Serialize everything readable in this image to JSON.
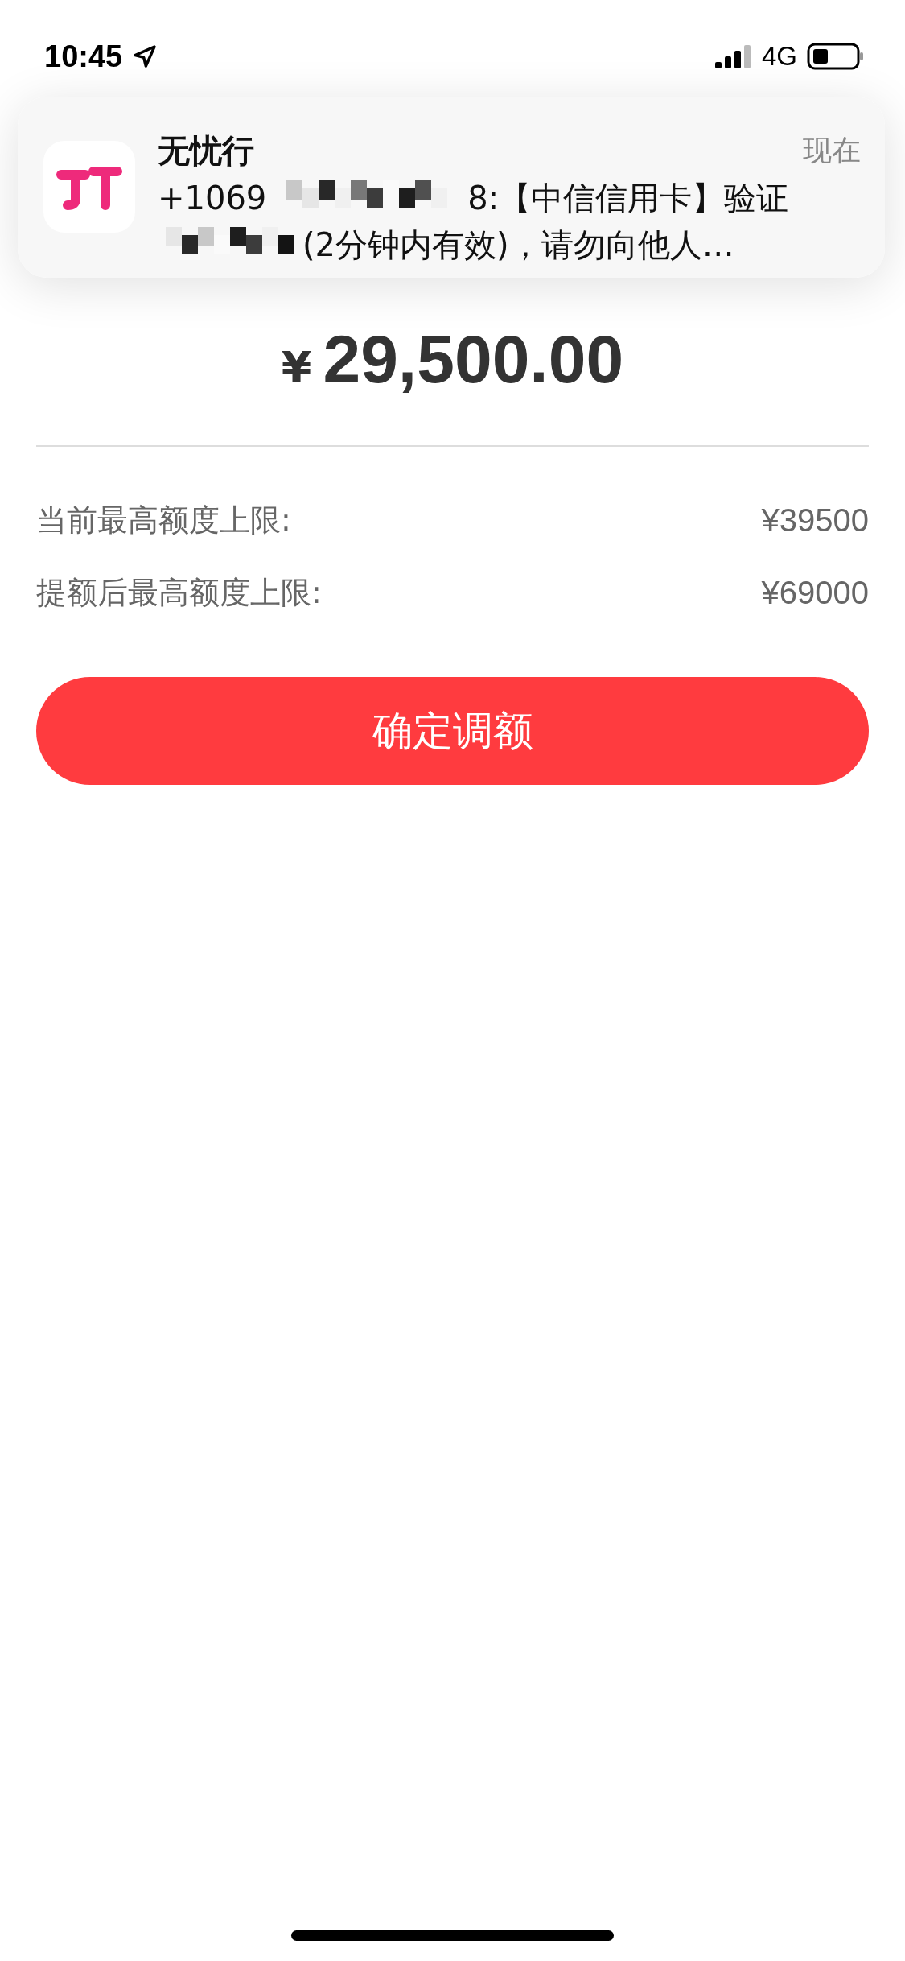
{
  "status_bar": {
    "time": "10:45",
    "network": "4G"
  },
  "notification": {
    "app": "无忧行",
    "time": "现在",
    "line_1_start": "+1069",
    "line_1_end": "8:【中信信用卡】验证",
    "line_2_end": "(2分钟内有效)，请勿向他人…"
  },
  "header": {
    "currency": "¥",
    "amount": "29,500.00"
  },
  "rows": [
    {
      "label": "当前最高额度上限:",
      "value": "¥39500"
    },
    {
      "label": "提额后最高额度上限:",
      "value": "¥69000"
    }
  ],
  "confirm_button": "确定调额"
}
